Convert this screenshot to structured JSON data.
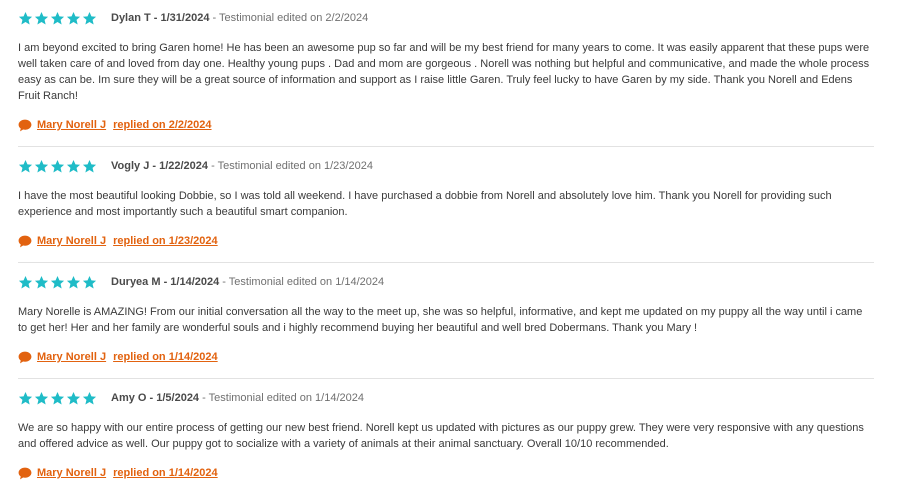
{
  "reviews": [
    {
      "author_line": "Dylan T - 1/31/2024",
      "edited": " - Testimonial edited on 2/2/2024",
      "rating": 5,
      "text": "I am beyond excited to bring Garen home! He has been an awesome pup so far and will be my best friend for many years to come. It was easily apparent that these pups were well taken care of and loved from day one. Healthy young pups . Dad and mom are gorgeous . Norell was nothing but helpful and communicative, and made the whole process easy as can be. Im sure they will be a great source of information and support as I raise little Garen. Truly feel lucky to have Garen by my side. Thank you Norell and Edens Fruit Ranch!",
      "reply_author": "Mary Norell J",
      "reply_date": "replied on 2/2/2024"
    },
    {
      "author_line": "Vogly J - 1/22/2024",
      "edited": " - Testimonial edited on 1/23/2024",
      "rating": 5,
      "text": "I have the most beautiful looking Dobbie, so I was told all weekend. I have purchased a dobbie from Norell and absolutely love him. Thank you Norell for providing such experience and most importantly such a beautiful smart companion.",
      "reply_author": "Mary Norell J",
      "reply_date": "replied on 1/23/2024"
    },
    {
      "author_line": "Duryea M - 1/14/2024",
      "edited": " - Testimonial edited on 1/14/2024",
      "rating": 5,
      "text": "Mary Norelle is AMAZING! From our initial conversation all the way to the meet up, she was so helpful, informative, and kept me updated on my puppy all the way until i came to get her! Her and her family are wonderful souls and i highly recommend buying her beautiful and well bred Dobermans. Thank you Mary !",
      "reply_author": "Mary Norell J",
      "reply_date": "replied on 1/14/2024"
    },
    {
      "author_line": "Amy O - 1/5/2024",
      "edited": " - Testimonial edited on 1/14/2024",
      "rating": 5,
      "text": "We are so happy with our entire process of getting our new best friend. Norell kept us updated with pictures as our puppy grew. They were very responsive with any questions and offered advice as well. Our puppy got to socialize with a variety of animals at their animal sanctuary. Overall 10/10 recommended.",
      "reply_author": "Mary Norell J",
      "reply_date": "replied on 1/14/2024"
    }
  ],
  "colors": {
    "star": "#1fbcc7",
    "reply": "#e2620f",
    "divider": "#e2e2e2"
  },
  "icons": {
    "rating": "star-icon",
    "reply": "speech-bubble-icon"
  }
}
